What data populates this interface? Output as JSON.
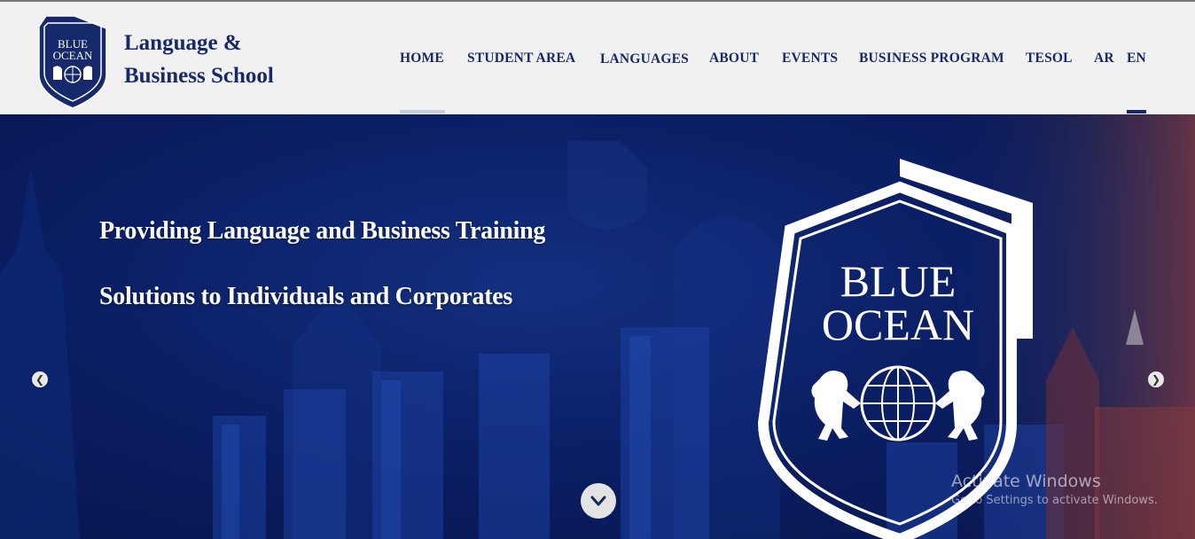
{
  "brand": {
    "line1": "Language &",
    "line2": "Business School",
    "logo_line1": "BLUE",
    "logo_line2": "OCEAN"
  },
  "nav": {
    "items": [
      {
        "label": "HOME",
        "active": true
      },
      {
        "label": "STUDENT AREA"
      },
      {
        "label": "LANGUAGES"
      },
      {
        "label": "ABOUT"
      },
      {
        "label": "EVENTS"
      },
      {
        "label": "BUSINESS PROGRAM"
      },
      {
        "label": "TESOL"
      },
      {
        "label": "AR"
      },
      {
        "label": "EN",
        "selected": true
      }
    ]
  },
  "hero": {
    "line1": "Providing Language and Business Training",
    "line2": "Solutions to Individuals and Corporates",
    "shield_line1": "BLUE",
    "shield_line2": "OCEAN",
    "prev_icon": "chevron-left-icon",
    "next_icon": "chevron-right-icon",
    "down_icon": "chevron-down-icon"
  },
  "watermark": {
    "title": "Activate Windows",
    "subtitle": "Go to Settings to activate Windows."
  },
  "colors": {
    "navy": "#16296b",
    "header_bg": "#f1f1f1",
    "hero_bg": "#0b1f66",
    "underline_active": "#c9cdd6",
    "underline_selected": "#16296b"
  }
}
